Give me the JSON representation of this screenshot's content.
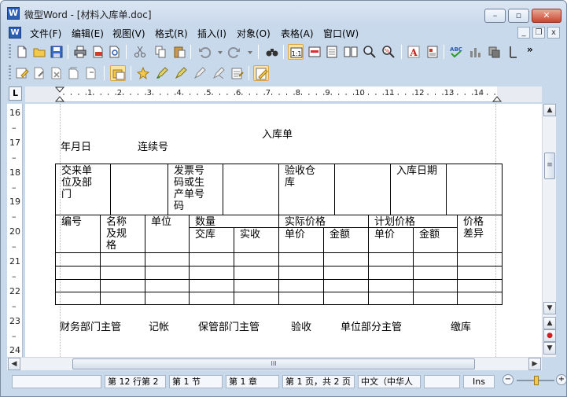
{
  "window": {
    "app_icon": "W",
    "title": "微型Word - [材料入库单.doc]",
    "min": "–",
    "max": "▫",
    "close": "✕"
  },
  "menu": [
    "文件(F)",
    "编辑(E)",
    "视图(V)",
    "格式(R)",
    "插入(I)",
    "对象(O)",
    "表格(A)",
    "窗口(W)"
  ],
  "mdi": {
    "min": "_",
    "restore": "❐",
    "close": "x"
  },
  "toolbar_more": "»",
  "ruler": {
    "corner": "L",
    "h_numbers": [
      "1",
      "2",
      "3",
      "4",
      "5",
      "6",
      "7",
      "8",
      "9",
      "10",
      "11",
      "12",
      "13",
      "14"
    ],
    "v_numbers": [
      "16",
      "17",
      "18",
      "19",
      "20",
      "21",
      "22",
      "23",
      "24"
    ]
  },
  "document": {
    "title": "入库单",
    "line1_left": "年月日",
    "line1_right": "连续号",
    "table": {
      "supplier": [
        "交来单",
        "位及部",
        "门"
      ],
      "invoice": [
        "发票号",
        "码或生",
        "产单号",
        "码"
      ],
      "warehouse": [
        "验收仓",
        "库"
      ],
      "date": "入库日期",
      "code": "编号",
      "name": [
        "名称",
        "及规",
        "格"
      ],
      "unit": "单位",
      "qty": "数量",
      "qty_recv": "交库",
      "qty_act": "实收",
      "actual_price": "实际价格",
      "ap_unit": "单价",
      "ap_amount": "金额",
      "plan_price": "计划价格",
      "pp_unit": "单价",
      "pp_amount": "金额",
      "diff": [
        "价格",
        "差异"
      ]
    },
    "footer": [
      "财务部门主管",
      "记帐",
      "保管部门主管",
      "验收",
      "单位部分主管",
      "缴库"
    ]
  },
  "scroll": {
    "grip": "≡",
    "hgrip": "III",
    "up": "▲",
    "down": "▼",
    "left": "◀",
    "right": "▶",
    "prev": "▲",
    "dot": "●",
    "next": "▼"
  },
  "status": [
    "第 12 行第 2",
    "第 1 节",
    "第 1 章",
    "第 1 页，共 2 页",
    "中文（中华人",
    "Ins"
  ],
  "zoom": {
    "minus": "−",
    "plus": "+"
  },
  "colors": {
    "title_bg": "#c9d9ec",
    "close_red": "#c9462c",
    "highlight": "#fbe3a4"
  }
}
